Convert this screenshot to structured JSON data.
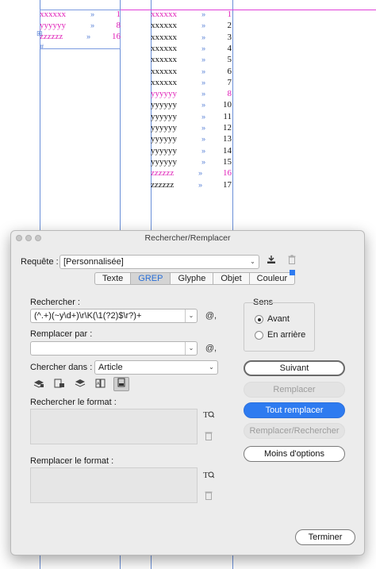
{
  "document": {
    "left_column": [
      {
        "word": "xxxxxx",
        "num": "1",
        "color": "pink"
      },
      {
        "word": "yyyyyy",
        "num": "8",
        "color": "pink"
      },
      {
        "word": "zzzzzz",
        "num": "16",
        "color": "pink"
      }
    ],
    "right_column": [
      {
        "word": "xxxxxx",
        "num": "1",
        "color": "pink"
      },
      {
        "word": "xxxxxx",
        "num": "2",
        "color": "black"
      },
      {
        "word": "xxxxxx",
        "num": "3",
        "color": "black"
      },
      {
        "word": "xxxxxx",
        "num": "4",
        "color": "black"
      },
      {
        "word": "xxxxxx",
        "num": "5",
        "color": "black"
      },
      {
        "word": "xxxxxx",
        "num": "6",
        "color": "black"
      },
      {
        "word": "xxxxxx",
        "num": "7",
        "color": "black"
      },
      {
        "word": "yyyyyy",
        "num": "8",
        "color": "pink"
      },
      {
        "word": "yyyyyy",
        "num": "10",
        "color": "black"
      },
      {
        "word": "yyyyyy",
        "num": "11",
        "color": "black"
      },
      {
        "word": "yyyyyy",
        "num": "12",
        "color": "black"
      },
      {
        "word": "yyyyyy",
        "num": "13",
        "color": "black"
      },
      {
        "word": "yyyyyy",
        "num": "14",
        "color": "black"
      },
      {
        "word": "yyyyyy",
        "num": "15",
        "color": "black"
      },
      {
        "word": "zzzzzz",
        "num": "16",
        "color": "pink"
      },
      {
        "word": "zzzzzz",
        "num": "17",
        "color": "black"
      }
    ],
    "colors": {
      "pink": "#e020b8",
      "guide": "#6a8fd8",
      "magenta_line": "#e040d8"
    }
  },
  "dialog": {
    "title": "Rechercher/Remplacer",
    "requete_label": "Requête :",
    "requete_value": "[Personnalisée]",
    "tabs": [
      "Texte",
      "GREP",
      "Glyphe",
      "Objet",
      "Couleur"
    ],
    "active_tab": "GREP",
    "rechercher_label": "Rechercher :",
    "rechercher_value": "(^.+)(~y\\d+)\\r\\K(\\1(?2)$\\r?)+",
    "remplacer_par_label": "Remplacer par :",
    "remplacer_par_value": "",
    "chercher_dans_label": "Chercher dans :",
    "chercher_dans_value": "Article",
    "rechercher_format_label": "Rechercher le format :",
    "remplacer_format_label": "Remplacer le format :",
    "special_char_glyph": "@,",
    "sens": {
      "label": "Sens",
      "avant": "Avant",
      "en_arriere": "En arrière",
      "selected": "Avant"
    },
    "buttons": {
      "suivant": "Suivant",
      "remplacer": "Remplacer",
      "tout_remplacer": "Tout remplacer",
      "remplacer_rechercher": "Remplacer/Rechercher",
      "moins_options": "Moins d'options",
      "terminer": "Terminer"
    },
    "accent_color": "#2e7bf0"
  }
}
